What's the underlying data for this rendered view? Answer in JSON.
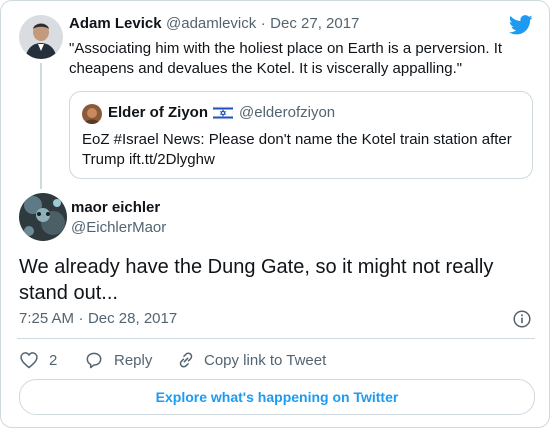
{
  "parent_tweet": {
    "author_name": "Adam Levick",
    "author_handle": "@adamlevick",
    "separator": "·",
    "date": "Dec 27, 2017",
    "text": "\"Associating him with the holiest place on Earth is a perversion. It cheapens and devalues the Kotel. It is viscerally appalling.\""
  },
  "quoted_tweet": {
    "author_name": "Elder of Ziyon",
    "author_handle": "@elderofziyon",
    "text": "EoZ #Israel News: Please don't name the Kotel train station after Trump ift.tt/2Dlyghw"
  },
  "main_tweet": {
    "author_name": "maor eichler",
    "author_handle": "@EichlerMaor",
    "text": "We already have the Dung Gate, so it might not really stand out...",
    "time": "7:25 AM",
    "separator": "·",
    "date": "Dec 28, 2017"
  },
  "actions": {
    "like_count": "2",
    "reply_label": "Reply",
    "copy_link_label": "Copy link to Tweet"
  },
  "footer": {
    "explore_label": "Explore what's happening on Twitter"
  },
  "colors": {
    "brand": "#1d9bf0",
    "muted_text": "#536471",
    "border": "#cfd9de"
  }
}
